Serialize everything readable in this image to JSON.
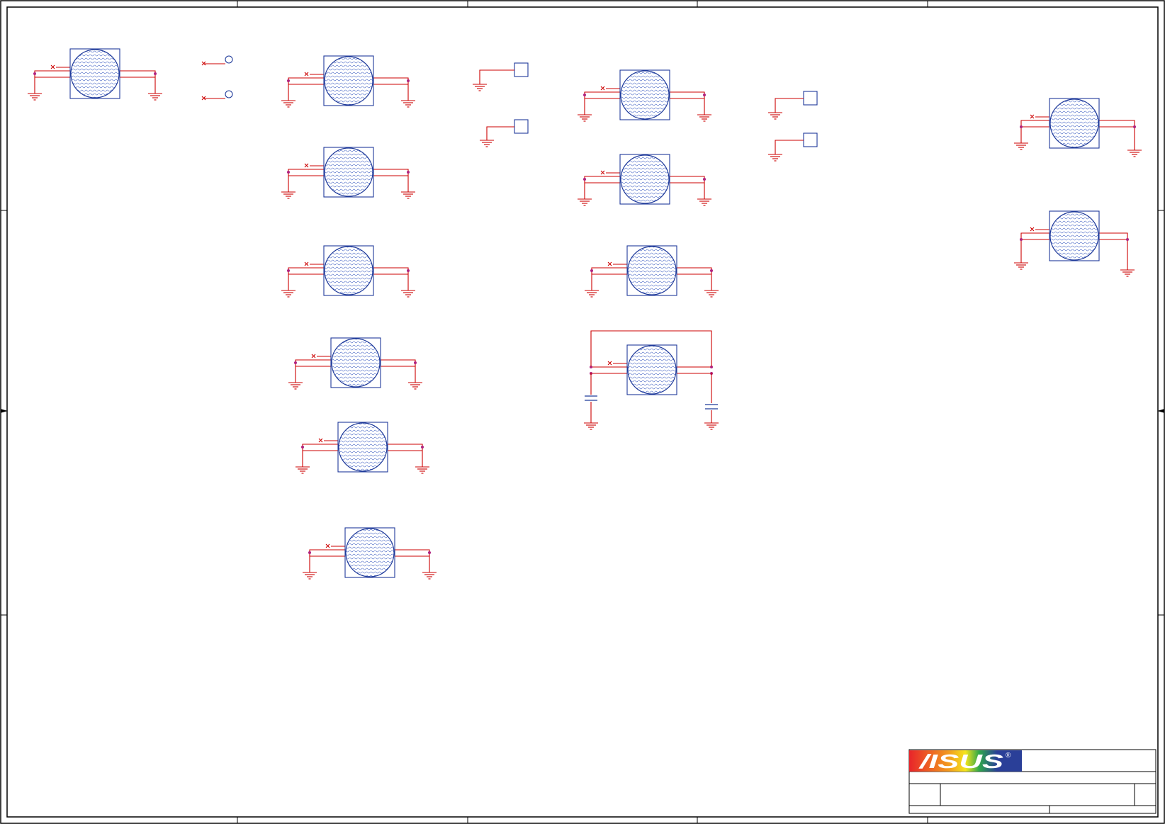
{
  "title_block": {
    "logo_text": "/ISUS",
    "registered_mark": "®"
  },
  "colors": {
    "wire": "#cc0000",
    "component_outline": "#1f3a9a",
    "junction": "#b0237f",
    "logo_red": "#e8242a",
    "logo_blue": "#2a3f98"
  },
  "icons": [
    "ground-icon",
    "mounting-hole-icon",
    "test-pad-icon",
    "test-point-icon",
    "capacitor-icon",
    "no-connect-icon",
    "junction-dot-icon"
  ]
}
